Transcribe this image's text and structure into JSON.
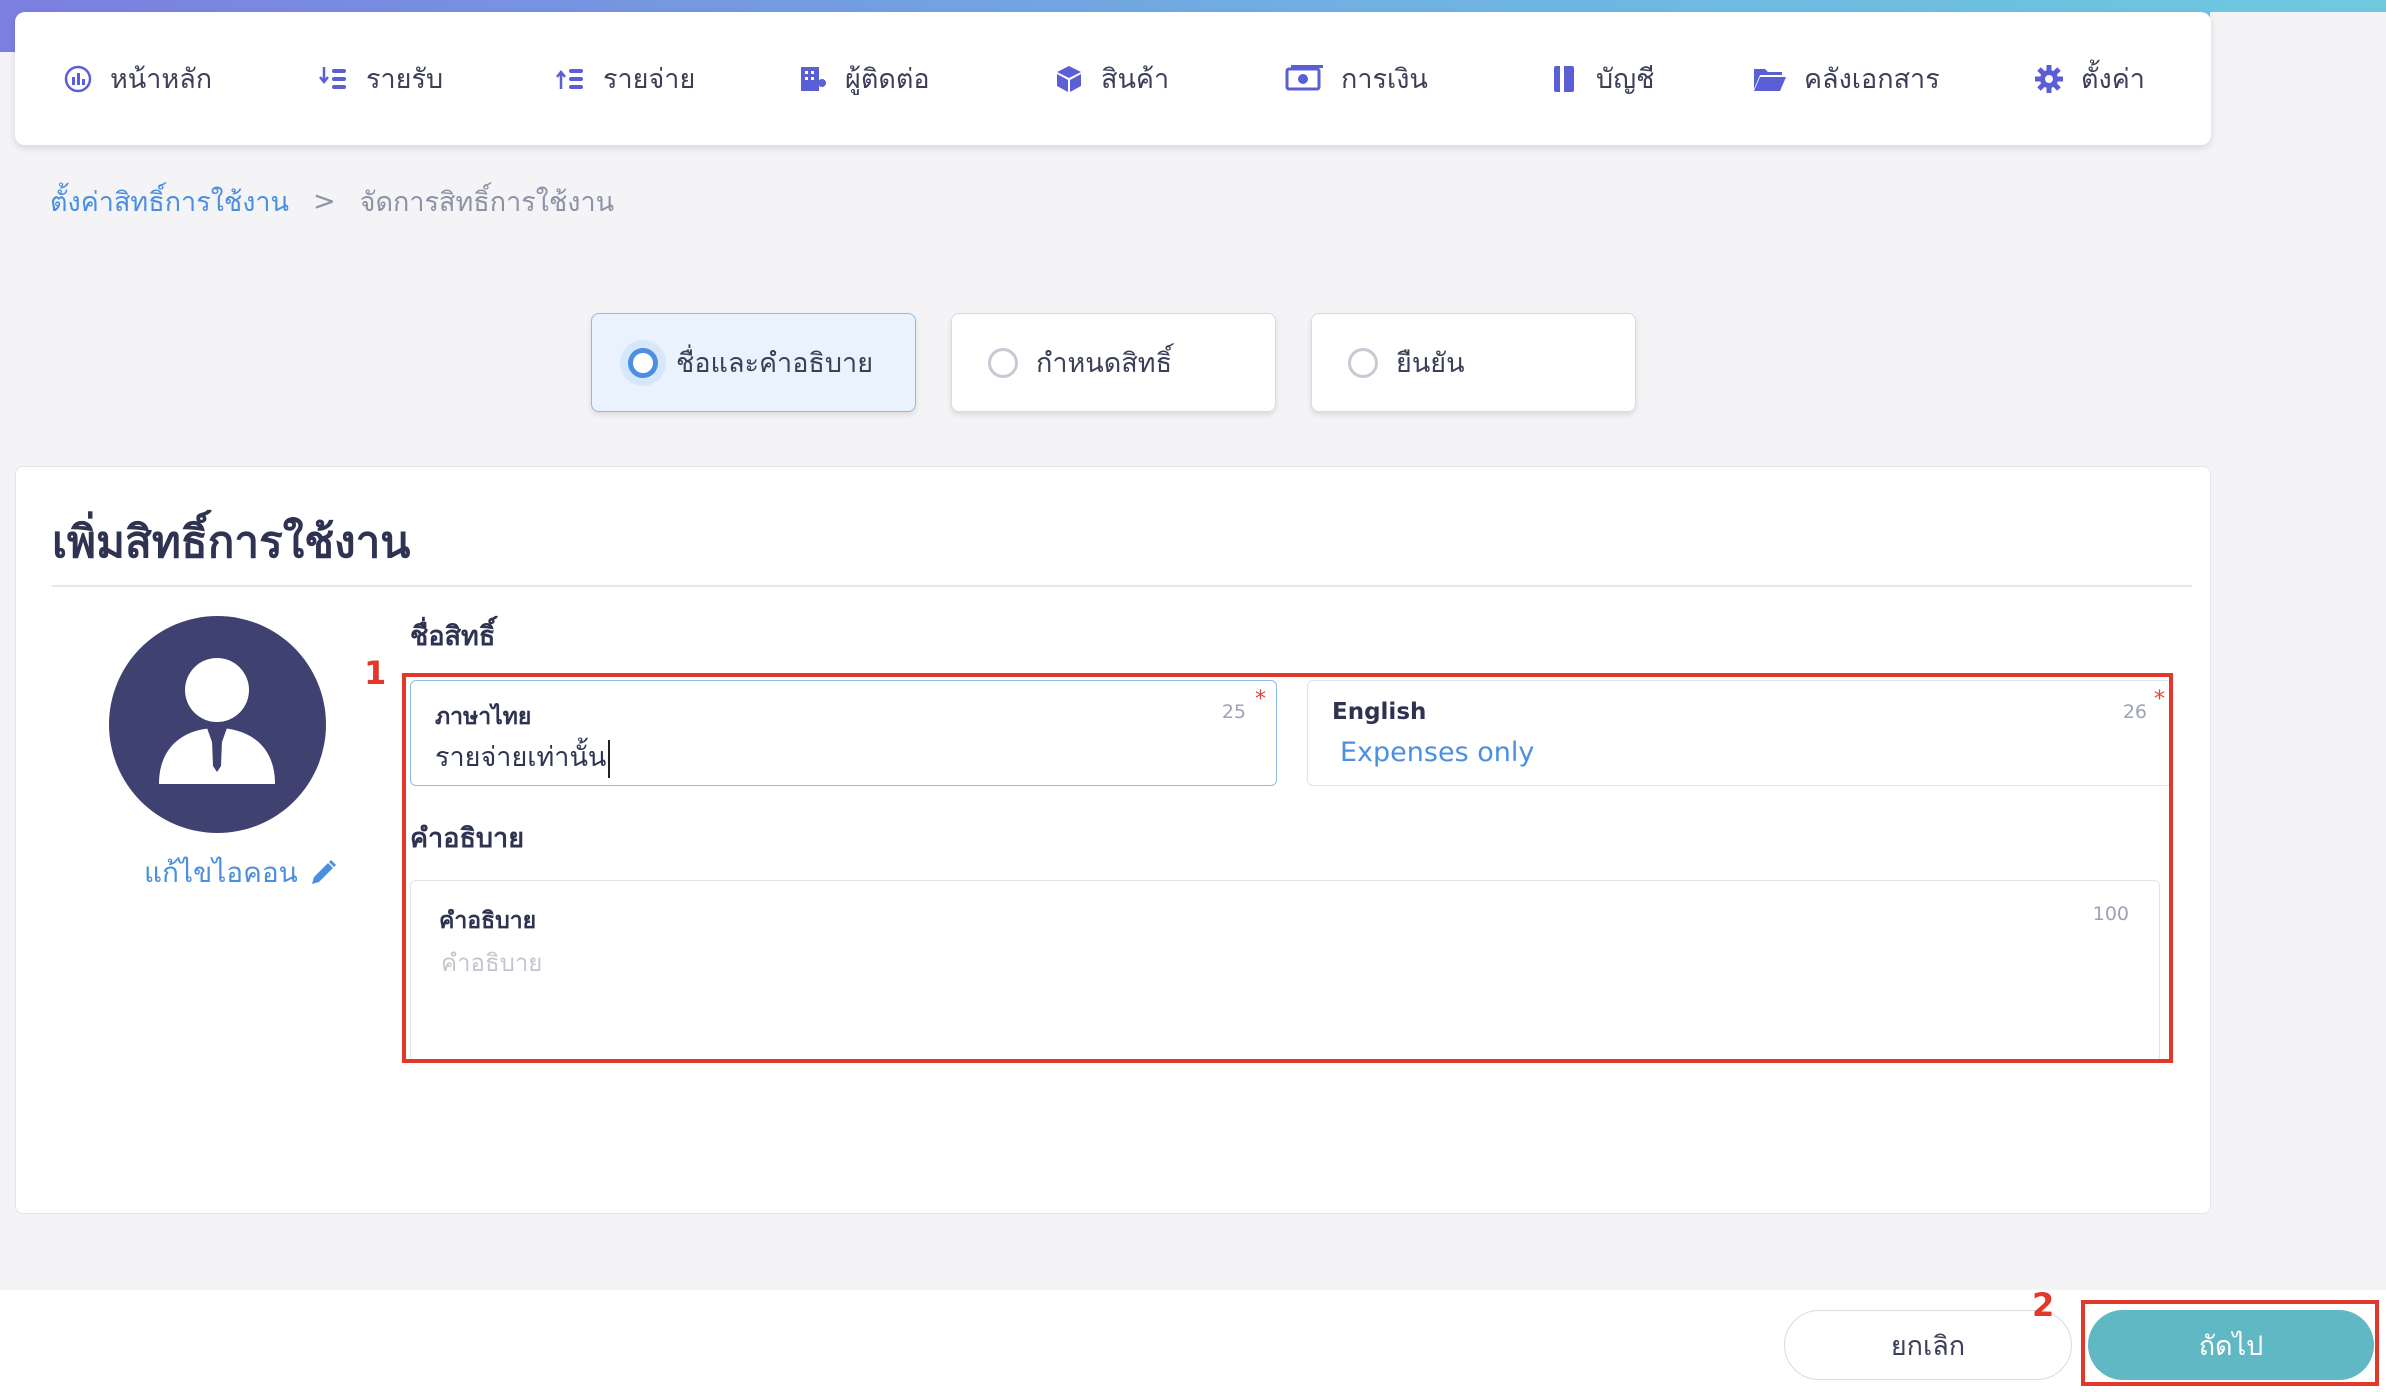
{
  "nav": {
    "items": [
      {
        "label": "หน้าหลัก",
        "icon": "dashboard-icon"
      },
      {
        "label": "รายรับ",
        "icon": "income-icon"
      },
      {
        "label": "รายจ่าย",
        "icon": "expense-icon"
      },
      {
        "label": "ผู้ติดต่อ",
        "icon": "building-icon"
      },
      {
        "label": "สินค้า",
        "icon": "box-icon"
      },
      {
        "label": "การเงิน",
        "icon": "money-icon"
      },
      {
        "label": "บัญชี",
        "icon": "ledger-icon"
      },
      {
        "label": "คลังเอกสาร",
        "icon": "folder-icon"
      },
      {
        "label": "ตั้งค่า",
        "icon": "gear-icon"
      }
    ],
    "icon_color": "#5b5fd6"
  },
  "breadcrumb": {
    "parent": "ตั้งค่าสิทธิ์การใช้งาน",
    "separator": ">",
    "current": "จัดการสิทธิ์การใช้งาน"
  },
  "steps": [
    {
      "label": "ชื่อและคำอธิบาย",
      "active": true
    },
    {
      "label": "กำหนดสิทธิ์",
      "active": false
    },
    {
      "label": "ยืนยัน",
      "active": false
    }
  ],
  "form": {
    "title": "เพิ่มสิทธิ์การใช้งาน",
    "edit_icon_label": "แก้ไขไอคอน",
    "name_section_label": "ชื่อสิทธิ์",
    "thai": {
      "label": "ภาษาไทย",
      "count": "25",
      "required": "*",
      "value": "รายจ่ายเท่านั้น"
    },
    "english": {
      "label": "English",
      "count": "26",
      "required": "*",
      "value": "Expenses only"
    },
    "description_section_label": "คำอธิบาย",
    "description": {
      "label": "คำอธิบาย",
      "count": "100",
      "placeholder": "คำอธิบาย"
    }
  },
  "annotations": {
    "box1": "1",
    "box2": "2"
  },
  "footer": {
    "cancel_label": "ยกเลิก",
    "next_label": "ถัดไป"
  },
  "colors": {
    "accent": "#4b8fe0",
    "next_button": "#5fb8c4",
    "annotation": "#e2382b",
    "avatar_bg": "#3f4270"
  }
}
